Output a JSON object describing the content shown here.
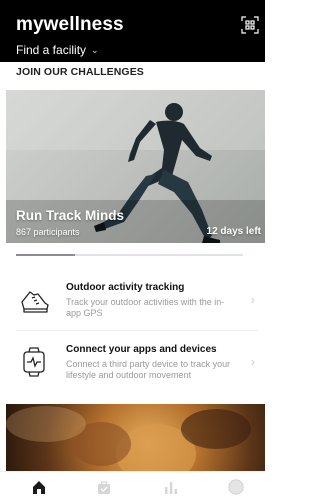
{
  "header": {
    "app_title": "mywellness",
    "facility_label": "Find a facility",
    "scan_icon": "qr-scan-icon"
  },
  "challenges": {
    "section_title": "JOIN OUR CHALLENGES",
    "featured": {
      "title": "Run Track Minds",
      "participants": "867 participants",
      "days_left": "12 days left"
    },
    "carousel_progress": 0.26
  },
  "actions": [
    {
      "icon": "running-shoe-icon",
      "title": "Outdoor activity tracking",
      "description": "Track your outdoor activities with the in-app GPS"
    },
    {
      "icon": "connected-devices-icon",
      "title": "Connect your apps and devices",
      "description": "Connect a third party device to track your lifestyle and outdoor movement"
    }
  ],
  "tabbar": {
    "tabs": [
      "home-icon",
      "workout-bag-icon",
      "stats-icon",
      "profile-icon"
    ],
    "active_tab": "home-icon"
  },
  "colors": {
    "header_bg": "#000000",
    "active_tab": "#1a1a1a",
    "inactive_tab": "#d6d6d6"
  }
}
